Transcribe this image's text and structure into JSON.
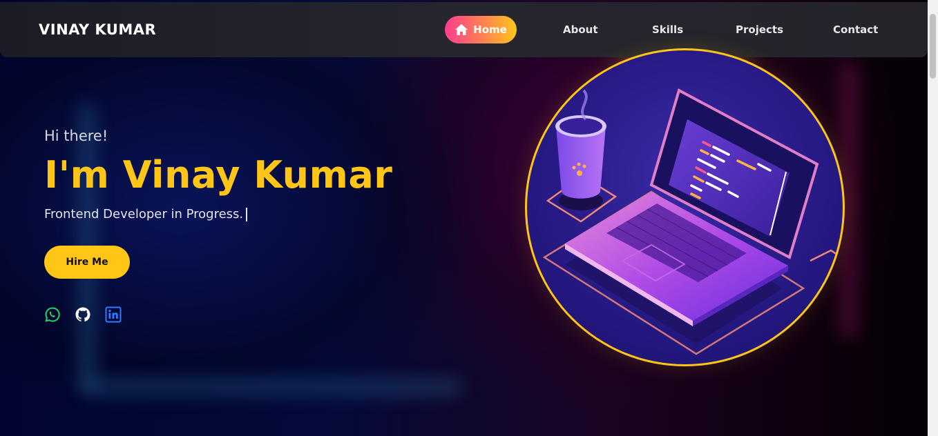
{
  "nav": {
    "brand": "VINAY KUMAR",
    "items": [
      {
        "label": "Home",
        "active": true
      },
      {
        "label": "About"
      },
      {
        "label": "Skills"
      },
      {
        "label": "Projects"
      },
      {
        "label": "Contact"
      }
    ]
  },
  "hero": {
    "greeting": "Hi there!",
    "headline": "I'm Vinay Kumar",
    "tagline": "Frontend Developer in Progress.",
    "cta_label": "Hire Me"
  },
  "social": [
    {
      "icon": "whatsapp-icon",
      "color": "#25d366"
    },
    {
      "icon": "github-icon",
      "color": "#ffffff"
    },
    {
      "icon": "linkedin-icon",
      "color": "#2f7bff"
    }
  ],
  "colors": {
    "accent": "#ffc617",
    "nav_home_gradient_start": "#ff3d8f",
    "nav_home_gradient_end": "#ffc61a"
  }
}
